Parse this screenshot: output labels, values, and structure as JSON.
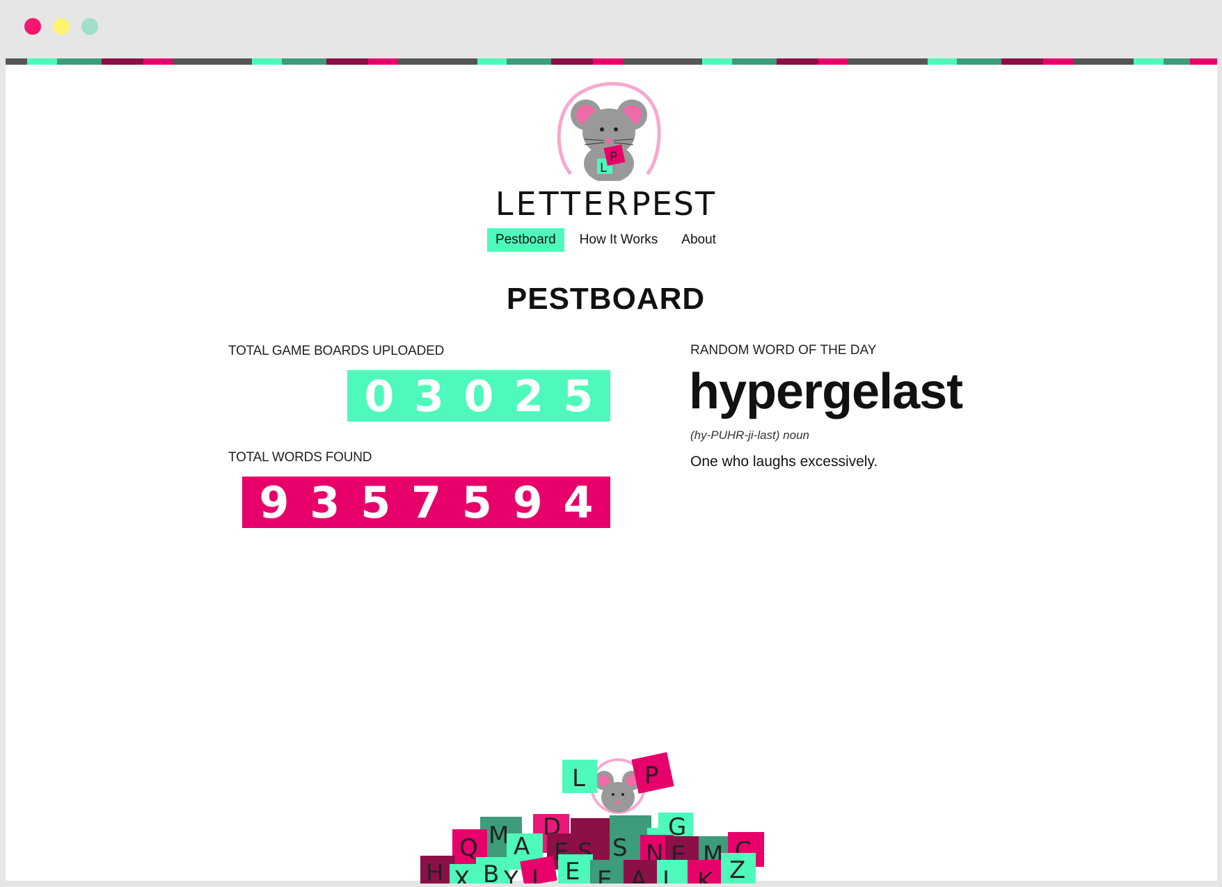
{
  "window": {
    "controls": [
      "close",
      "minimize",
      "maximize"
    ]
  },
  "brand": {
    "name_light": "LETTER",
    "name_bold": "PEST",
    "logo_tile_left": "L",
    "logo_tile_right": "P"
  },
  "nav": {
    "items": [
      {
        "label": "Pestboard",
        "active": true
      },
      {
        "label": "How It Works",
        "active": false
      },
      {
        "label": "About",
        "active": false
      }
    ]
  },
  "page": {
    "title": "PESTBOARD"
  },
  "stats": {
    "boards_label": "TOTAL GAME BOARDS UPLOADED",
    "boards_digits": [
      "0",
      "3",
      "0",
      "2",
      "5"
    ],
    "words_label": "TOTAL WORDS FOUND",
    "words_digits": [
      "9",
      "3",
      "5",
      "7",
      "5",
      "9",
      "4"
    ]
  },
  "word_of_day": {
    "label": "RANDOM WORD OF THE DAY",
    "word": "hypergelast",
    "pronunciation": "(hy-PUHR-ji-last) noun",
    "definition": "One who laughs excessively."
  },
  "footer_pile": {
    "tiles": [
      "L",
      "P",
      "Q",
      "M",
      "A",
      "D",
      "E",
      "S",
      "S",
      "N",
      "G",
      "E",
      "M",
      "C",
      "H",
      "X",
      "B",
      "Y",
      "I",
      "E",
      "E",
      "A",
      "I",
      "K",
      "Z"
    ]
  },
  "colors": {
    "mint": "#4dfabb",
    "pink": "#e8006a",
    "teal": "#3d9c7a",
    "plum": "#8c1048",
    "dark": "#555555"
  }
}
